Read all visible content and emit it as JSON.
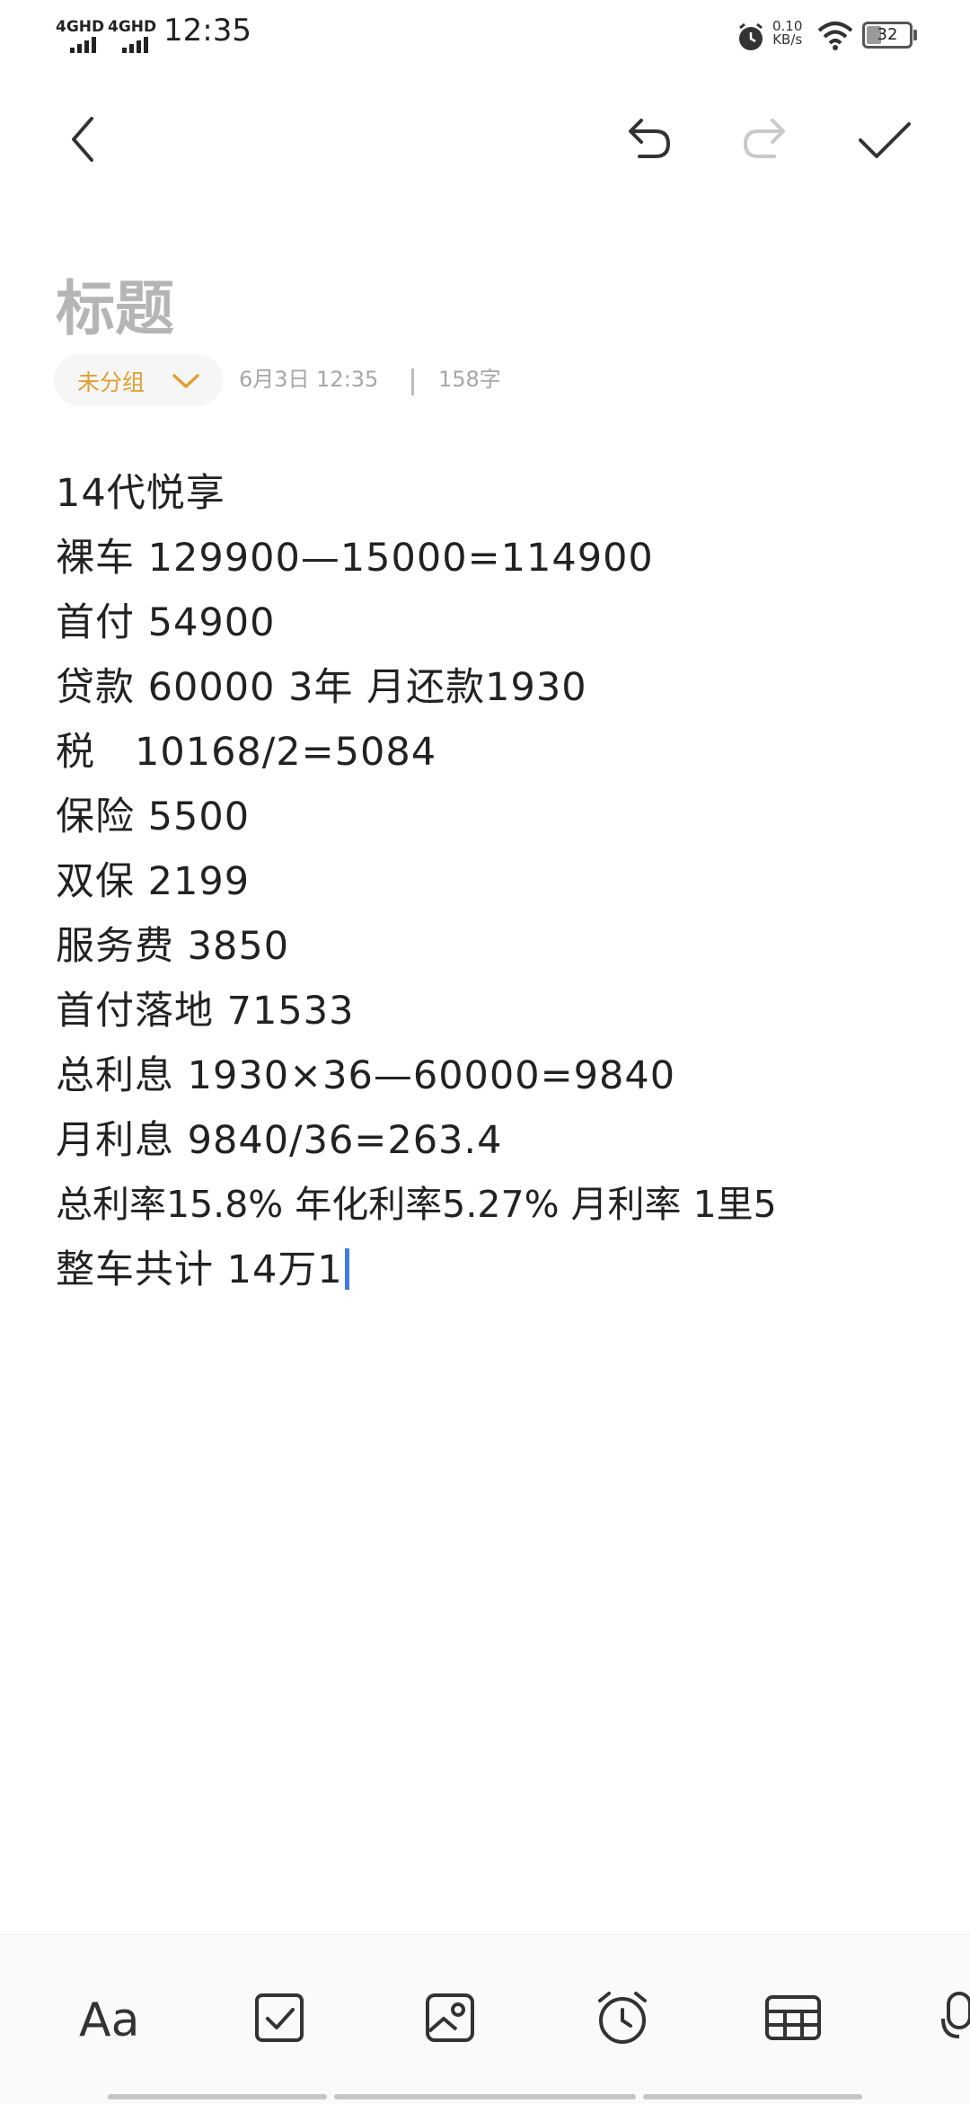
{
  "status_bar": {
    "signal1": "4GHD",
    "signal2": "4GHD",
    "time": "12:35",
    "speed_value": "0.10",
    "speed_unit": "KB/s",
    "battery": "32"
  },
  "toolbar": {
    "back": "back-icon",
    "undo": "undo-icon",
    "redo": "redo-icon",
    "done": "check-icon"
  },
  "note": {
    "title_placeholder": "标题",
    "group": "未分组",
    "date": "6月3日 12:35",
    "word_count": "158字",
    "lines": [
      "14代悦享",
      "裸车 129900—15000=114900",
      "首付 54900",
      "贷款 60000 3年 月还款1930",
      "税   10168/2=5084",
      "保险 5500",
      "双保 2199",
      "服务费 3850",
      "首付落地 71533",
      "总利息 1930×36—60000=9840",
      "月利息 9840/36=263.4",
      "总利率15.8% 年化利率5.27% 月利率 1里5",
      "整车共计 14万1"
    ]
  },
  "bottom_tools": {
    "text_format": "Aa",
    "items": [
      "checkbox-icon",
      "image-icon",
      "alarm-icon",
      "table-icon",
      "mic-icon"
    ]
  }
}
